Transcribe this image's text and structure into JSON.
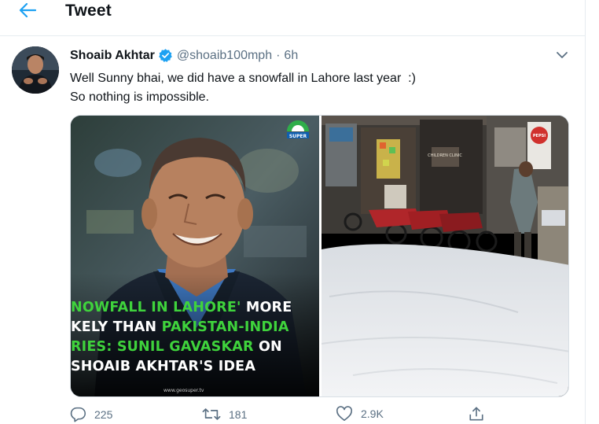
{
  "header": {
    "title": "Tweet",
    "back_icon": "arrow-left-icon"
  },
  "tweet": {
    "author_name": "Shoaib Akhtar",
    "handle": "@shoaib100mph",
    "separator": "·",
    "time": "6h",
    "text_line1": "Well Sunny bhai, we did have a snowfall in Lahore last year  :)",
    "text_line2": "So nothing is impossible.",
    "verified_icon": "verified-badge-icon",
    "menu_icon": "chevron-down-icon"
  },
  "media": {
    "left": {
      "caption": {
        "l1_green": "NOWFALL IN LAHORE'",
        "l1_white": " MORE",
        "l2_white": "KELY THAN ",
        "l2_green": "PAKISTAN-INDIA",
        "l3_green": "RIES: SUNIL GAVASKAR",
        "l3_white": " ON",
        "l4_white": " SHOAIB AKHTAR'S IDEA"
      },
      "logo_text": "SUPER",
      "site": "www.geosuper.tv"
    },
    "right": {
      "sign_clinic": "CHILDREN CLINIC",
      "sign_pepsi": "PEPSI"
    }
  },
  "actions": {
    "reply_count": "225",
    "retweet_count": "181",
    "like_count": "2.9K"
  },
  "colors": {
    "accent": "#1da1f2",
    "muted": "#5b7083",
    "caption_green": "#3fd33c"
  }
}
